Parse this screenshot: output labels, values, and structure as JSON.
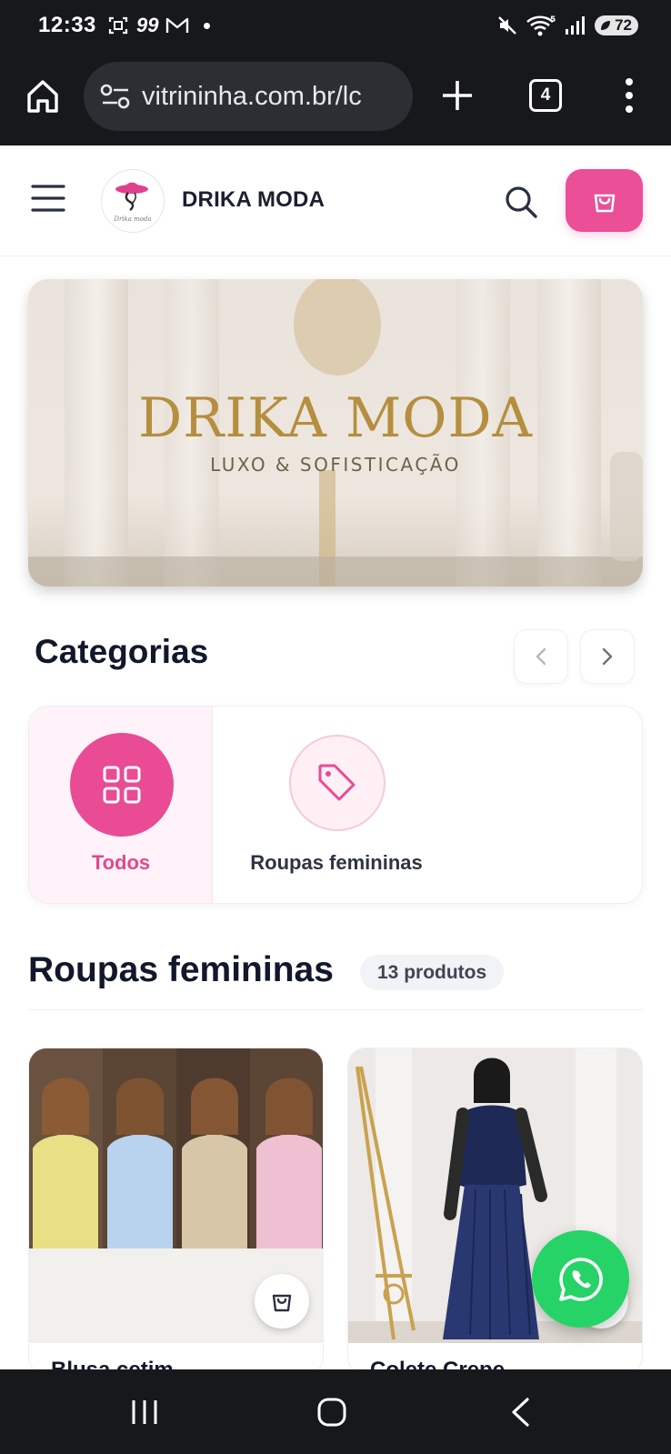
{
  "status_bar": {
    "time": "12:33",
    "notification_count": "99",
    "battery": "72",
    "icons": [
      "screenshot-icon",
      "gmail-icon",
      "mute-icon",
      "wifi-icon",
      "signal-icon",
      "battery-icon"
    ]
  },
  "browser": {
    "url": "vitrininha.com.br/lc",
    "tab_count": "4",
    "icons": [
      "home-icon",
      "site-settings-icon",
      "plus-icon",
      "more-vert-icon"
    ]
  },
  "header": {
    "store_name": "DRIKA MODA",
    "logo_text": "Drika moda",
    "icons": [
      "hamburger-icon",
      "search-icon",
      "shopping-bag-icon"
    ]
  },
  "banner": {
    "title": "DRIKA MODA",
    "subtitle": "LUXO & SOFISTICAÇÃO"
  },
  "categories": {
    "title": "Categorias",
    "items": [
      {
        "label": "Todos",
        "icon": "grid-icon",
        "selected": true
      },
      {
        "label": "Roupas femininas",
        "icon": "tag-icon",
        "selected": false
      }
    ]
  },
  "products": {
    "title": "Roupas femininas",
    "count_label": "13 produtos",
    "items": [
      {
        "title": "Blusa cetim"
      },
      {
        "title": "Colete Crepe"
      }
    ]
  },
  "colors": {
    "accent": "#ea4f98",
    "whatsapp": "#26d366",
    "system_bar": "#17181b"
  }
}
